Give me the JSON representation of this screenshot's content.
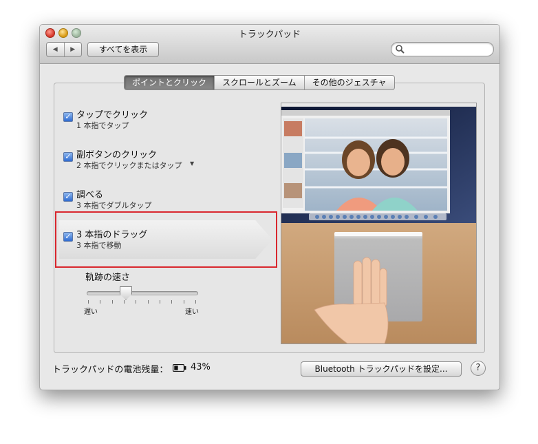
{
  "window": {
    "title": "トラックパッド",
    "show_all_label": "すべてを表示",
    "back_icon": "◀",
    "forward_icon": "▶",
    "search_placeholder": ""
  },
  "tabs": [
    {
      "label": "ポイントとクリック",
      "active": true
    },
    {
      "label": "スクロールとズーム",
      "active": false
    },
    {
      "label": "その他のジェスチャ",
      "active": false
    }
  ],
  "options": [
    {
      "title": "タップでクリック",
      "subtitle": "1 本指でタップ",
      "checked": true
    },
    {
      "title": "副ボタンのクリック",
      "subtitle": "2 本指でクリックまたはタップ",
      "checked": true
    },
    {
      "title": "調べる",
      "subtitle": "3 本指でダブルタップ",
      "checked": true
    },
    {
      "title": "3 本指のドラッグ",
      "subtitle": "3 本指で移動",
      "checked": true
    }
  ],
  "tracking_speed": {
    "label": "軌跡の速さ",
    "min_label": "遅い",
    "max_label": "速い",
    "value": 0.35,
    "ticks": 10
  },
  "footer": {
    "battery_label": "トラックパッドの電池残量：",
    "battery_value": "43%",
    "battery_level": 0.43,
    "bluetooth_button": "Bluetooth トラックパッドを設定...",
    "help_label": "?"
  },
  "colors": {
    "highlight_border": "#d9272e",
    "checkbox_blue": "#2f6bd1"
  }
}
